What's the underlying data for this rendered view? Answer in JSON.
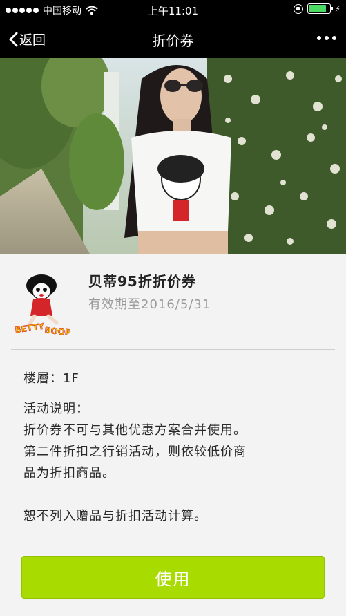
{
  "status_bar": {
    "carrier": "中国移动",
    "time": "上午11:01",
    "battery_level": 0.85
  },
  "nav": {
    "back_label": "返回",
    "title": "折价券"
  },
  "coupon": {
    "title": "贝蒂95折折价券",
    "validity": "有效期至2016/5/31",
    "brand_logo_text": "BETTY BOOP"
  },
  "details": {
    "floor": "楼層：1F",
    "desc_heading": "活动说明：",
    "desc_lines": [
      "折价券不可与其他优惠方案合并使用。",
      "第二件折扣之行销活动，则依较低价商",
      "品为折扣商品。",
      "恕不列入赠品与折扣活动计算。"
    ]
  },
  "action": {
    "use_label": "使用"
  },
  "colors": {
    "accent": "#a8db00",
    "nav_bg": "#000000"
  }
}
